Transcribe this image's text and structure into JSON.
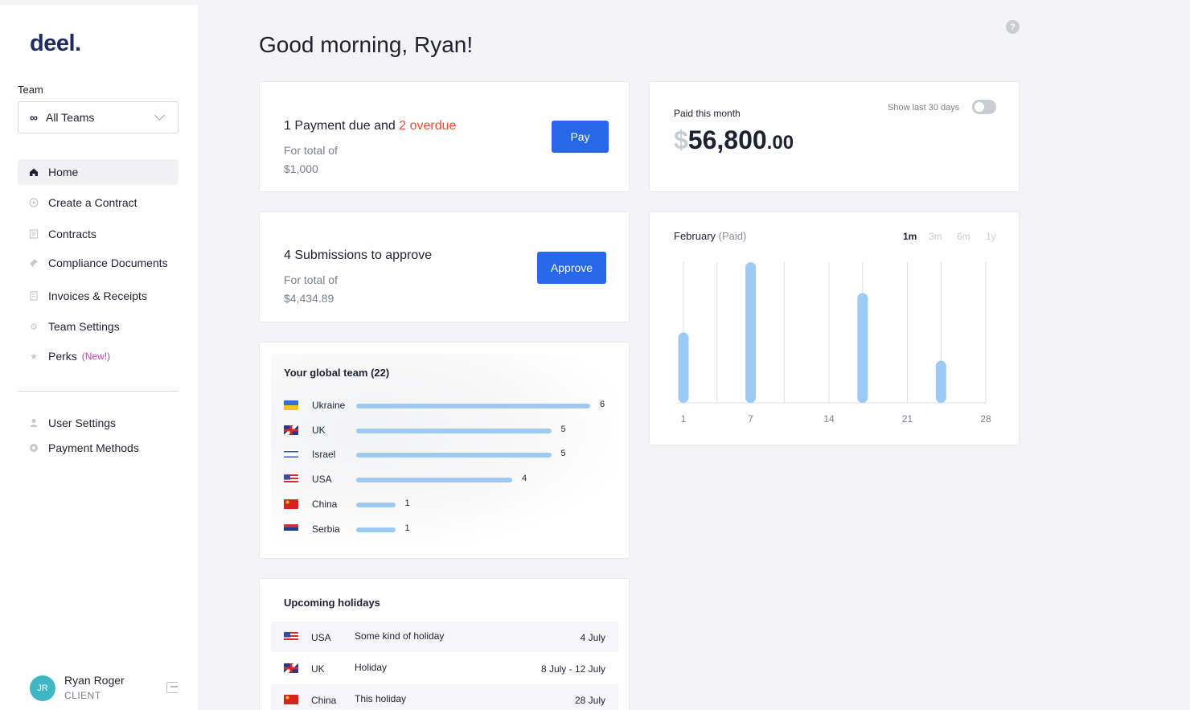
{
  "brand": {
    "logo": "deel",
    "logo_dot": "."
  },
  "sidebar": {
    "team_label": "Team",
    "team_select": {
      "icon": "infinity-icon",
      "value": "All Teams"
    },
    "nav": [
      {
        "label": "Home",
        "icon": "home-icon",
        "active": true
      },
      {
        "label": "Create a Contract",
        "icon": "plus-circle-icon"
      },
      {
        "label": "Contracts",
        "icon": "document-icon"
      },
      {
        "label": "Compliance Documents",
        "icon": "pin-icon"
      },
      {
        "label": "Invoices & Receipts",
        "icon": "receipt-icon"
      },
      {
        "label": "Team Settings",
        "icon": "gear-icon"
      },
      {
        "label": "Perks",
        "icon": "star-icon",
        "badge": "(New!)"
      }
    ],
    "secondary_nav": [
      {
        "label": "User Settings",
        "icon": "user-icon"
      },
      {
        "label": "Payment Methods",
        "icon": "card-icon"
      }
    ],
    "user": {
      "initials": "JR",
      "name": "Ryan Roger",
      "role": "CLIENT"
    }
  },
  "header": {
    "greeting": "Good morning, Ryan!"
  },
  "payment_card": {
    "title_prefix": "1 Payment due and ",
    "overdue": "2 overdue",
    "sub_label": "For total of",
    "amount": "$1,000",
    "button": "Pay"
  },
  "submissions_card": {
    "title": "4 Submissions to approve",
    "sub_label": "For total of",
    "amount": "$4,434.89",
    "button": "Approve"
  },
  "paid_card": {
    "label": "Paid this month",
    "currency": "$",
    "amount_main": "56,800",
    "amount_cents": ".00",
    "toggle_label": "Show last 30 days",
    "toggle_on": false
  },
  "chart_card": {
    "month": "February",
    "status": "(Paid)",
    "ranges": [
      "1m",
      "3m",
      "6m",
      "1y"
    ],
    "active_range": "1m"
  },
  "chart_data": {
    "type": "bar",
    "title": "February (Paid)",
    "xlabel": "",
    "ylabel": "",
    "x_ticks": [
      1,
      7,
      14,
      21,
      28
    ],
    "xlim": [
      1,
      28
    ],
    "ylim": [
      0,
      1
    ],
    "series": [
      {
        "values": [
          {
            "x": 1,
            "y": 0.5
          },
          {
            "x": 7,
            "y": 1.0
          },
          {
            "x": 17,
            "y": 0.78
          },
          {
            "x": 24,
            "y": 0.3
          }
        ]
      }
    ],
    "gridlines_x": [
      1,
      4,
      7,
      10,
      14,
      17,
      21,
      24,
      28
    ],
    "color": "#9ccaf5"
  },
  "global_team": {
    "title": "Your global team (22)",
    "rows": [
      {
        "country": "Ukraine",
        "count": 6,
        "flag": "ukraine-flag-icon"
      },
      {
        "country": "UK",
        "count": 5,
        "flag": "uk-flag-icon"
      },
      {
        "country": "Israel",
        "count": 5,
        "flag": "israel-flag-icon"
      },
      {
        "country": "USA",
        "count": 4,
        "flag": "usa-flag-icon"
      },
      {
        "country": "China",
        "count": 1,
        "flag": "china-flag-icon"
      },
      {
        "country": "Serbia",
        "count": 1,
        "flag": "serbia-flag-icon"
      }
    ],
    "max": 6
  },
  "holidays": {
    "title": "Upcoming holidays",
    "rows": [
      {
        "country": "USA",
        "name": "Some kind of holiday",
        "date": "4 July",
        "flag": "usa-flag-icon"
      },
      {
        "country": "UK",
        "name": "Holiday",
        "date": "8 July - 12 July",
        "flag": "uk-flag-icon"
      },
      {
        "country": "China",
        "name": "This holiday",
        "date": "28 July",
        "flag": "china-flag-icon"
      }
    ]
  }
}
